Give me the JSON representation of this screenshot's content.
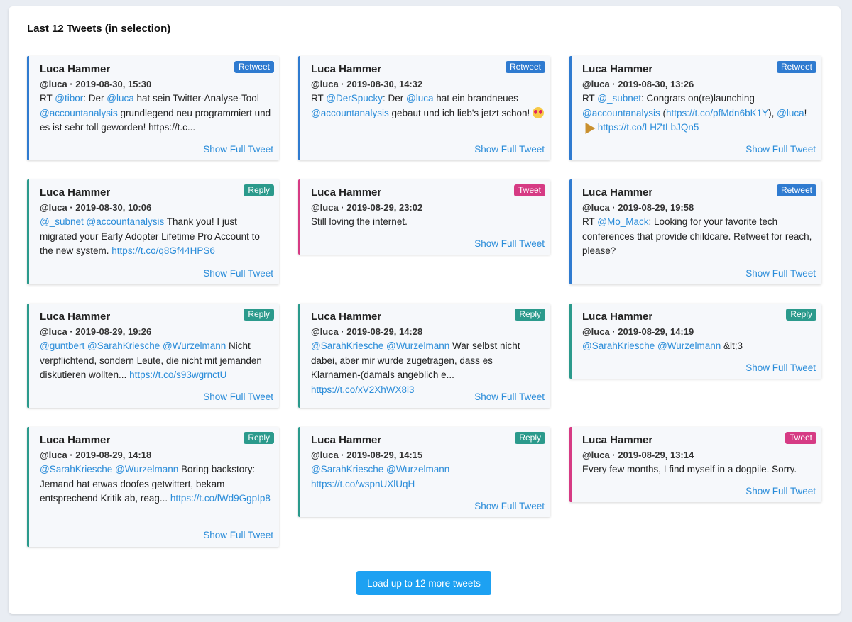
{
  "panel": {
    "title": "Last 12 Tweets (in selection)"
  },
  "show_full_label": "Show Full Tweet",
  "load_more_label": "Load up to 12 more tweets",
  "colors": {
    "retweet": "#2f7bd0",
    "reply": "#2b9a8c",
    "tweet": "#d63b84",
    "link": "#2a8cd9",
    "button": "#1da1f2"
  },
  "tweets": [
    {
      "author": "Luca Hammer",
      "type": "Retweet",
      "meta": "@luca · 2019-08-30, 15:30",
      "segments": [
        {
          "t": "RT "
        },
        {
          "t": "@tibor",
          "link": true
        },
        {
          "t": ": Der "
        },
        {
          "t": "@luca",
          "link": true
        },
        {
          "t": " hat sein Twitter-Analyse-Tool "
        },
        {
          "t": "@accountanalysis",
          "link": true
        },
        {
          "t": " grundlegend neu programmiert und es ist sehr toll geworden! https://t.c..."
        }
      ]
    },
    {
      "author": "Luca Hammer",
      "type": "Retweet",
      "meta": "@luca · 2019-08-30, 14:32",
      "segments": [
        {
          "t": "RT "
        },
        {
          "t": "@DerSpucky",
          "link": true
        },
        {
          "t": ": Der "
        },
        {
          "t": "@luca",
          "link": true
        },
        {
          "t": " hat ein brandneues "
        },
        {
          "t": "@accountanalysis",
          "link": true
        },
        {
          "t": " gebaut und ich lieb's jetzt schon! "
        },
        {
          "emoji": "heart-eyes"
        }
      ]
    },
    {
      "author": "Luca Hammer",
      "type": "Retweet",
      "meta": "@luca · 2019-08-30, 13:26",
      "segments": [
        {
          "t": "RT "
        },
        {
          "t": "@_subnet",
          "link": true
        },
        {
          "t": ": Congrats on(re)launching "
        },
        {
          "t": "@accountanalysis",
          "link": true
        },
        {
          "t": " ("
        },
        {
          "t": "https://t.co/pfMdn6bK1Y",
          "link": true
        },
        {
          "t": "), "
        },
        {
          "t": "@luca",
          "link": true
        },
        {
          "t": "! "
        },
        {
          "emoji": "party-popper"
        },
        {
          "t": " "
        },
        {
          "t": "https://t.co/LHZtLbJQn5",
          "link": true
        }
      ]
    },
    {
      "author": "Luca Hammer",
      "type": "Reply",
      "meta": "@luca · 2019-08-30, 10:06",
      "segments": [
        {
          "t": "@_subnet",
          "link": true
        },
        {
          "t": " "
        },
        {
          "t": "@accountanalysis",
          "link": true
        },
        {
          "t": " Thank you! I just migrated your Early Adopter Lifetime Pro Account to the new system. "
        },
        {
          "t": "https://t.co/q8Gf44HPS6",
          "link": true
        }
      ]
    },
    {
      "author": "Luca Hammer",
      "type": "Tweet",
      "meta": "@luca · 2019-08-29, 23:02",
      "segments": [
        {
          "t": "Still loving the internet."
        }
      ]
    },
    {
      "author": "Luca Hammer",
      "type": "Retweet",
      "meta": "@luca · 2019-08-29, 19:58",
      "segments": [
        {
          "t": "RT "
        },
        {
          "t": "@Mo_Mack",
          "link": true
        },
        {
          "t": ": Looking for your favorite tech conferences that provide childcare. Retweet for reach, please?"
        }
      ]
    },
    {
      "author": "Luca Hammer",
      "type": "Reply",
      "meta": "@luca · 2019-08-29, 19:26",
      "segments": [
        {
          "t": "@guntbert",
          "link": true
        },
        {
          "t": " "
        },
        {
          "t": "@SarahKriesche",
          "link": true
        },
        {
          "t": " "
        },
        {
          "t": "@Wurzelmann",
          "link": true
        },
        {
          "t": " Nicht verpflichtend, sondern Leute, die nicht mit jemanden diskutieren wollten... "
        },
        {
          "t": "https://t.co/s93wgrnctU",
          "link": true
        }
      ]
    },
    {
      "author": "Luca Hammer",
      "type": "Reply",
      "meta": "@luca · 2019-08-29, 14:28",
      "segments": [
        {
          "t": "@SarahKriesche",
          "link": true
        },
        {
          "t": " "
        },
        {
          "t": "@Wurzelmann",
          "link": true
        },
        {
          "t": " War selbst nicht dabei, aber mir wurde zugetragen, dass es Klarnamen-(damals angeblich e... "
        },
        {
          "t": "https://t.co/xV2XhWX8i3",
          "link": true
        }
      ]
    },
    {
      "author": "Luca Hammer",
      "type": "Reply",
      "meta": "@luca · 2019-08-29, 14:19",
      "segments": [
        {
          "t": "@SarahKriesche",
          "link": true
        },
        {
          "t": " "
        },
        {
          "t": "@Wurzelmann",
          "link": true
        },
        {
          "t": " &lt;3"
        }
      ]
    },
    {
      "author": "Luca Hammer",
      "type": "Reply",
      "meta": "@luca · 2019-08-29, 14:18",
      "segments": [
        {
          "t": "@SarahKriesche",
          "link": true
        },
        {
          "t": " "
        },
        {
          "t": "@Wurzelmann",
          "link": true
        },
        {
          "t": " Boring backstory: Jemand hat etwas doofes getwittert, bekam entsprechend Kritik ab, reag... "
        },
        {
          "t": "https://t.co/lWd9GgpIp8",
          "link": true
        }
      ]
    },
    {
      "author": "Luca Hammer",
      "type": "Reply",
      "meta": "@luca · 2019-08-29, 14:15",
      "segments": [
        {
          "t": "@SarahKriesche",
          "link": true
        },
        {
          "t": " "
        },
        {
          "t": "@Wurzelmann",
          "link": true
        },
        {
          "t": " "
        },
        {
          "t": "https://t.co/wspnUXlUqH",
          "link": true
        }
      ]
    },
    {
      "author": "Luca Hammer",
      "type": "Tweet",
      "meta": "@luca · 2019-08-29, 13:14",
      "segments": [
        {
          "t": "Every few months, I find myself in a dogpile. Sorry."
        }
      ]
    }
  ]
}
